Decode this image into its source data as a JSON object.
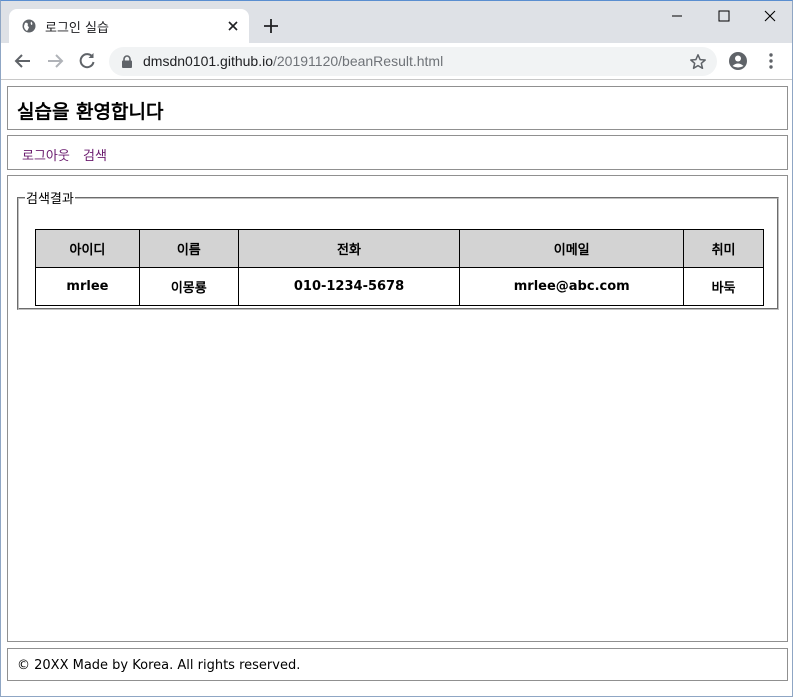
{
  "browser": {
    "tab_title": "로그인 실습",
    "url_host": "dmsdn0101.github.io",
    "url_path": "/20191120/beanResult.html"
  },
  "page": {
    "title": "실습을 환영합니다",
    "nav": {
      "logout": "로그아웃",
      "search": "검색"
    },
    "result": {
      "legend": "검색결과",
      "columns": [
        "아이디",
        "이름",
        "전화",
        "이메일",
        "취미"
      ],
      "rows": [
        [
          "mrlee",
          "이몽룡",
          "010-1234-5678",
          "mrlee@abc.com",
          "바둑"
        ]
      ]
    },
    "footer": "© 20XX Made by Korea. All rights reserved."
  },
  "colors": {
    "link": "#6a1b6e",
    "table_header_bg": "#d3d3d3"
  }
}
